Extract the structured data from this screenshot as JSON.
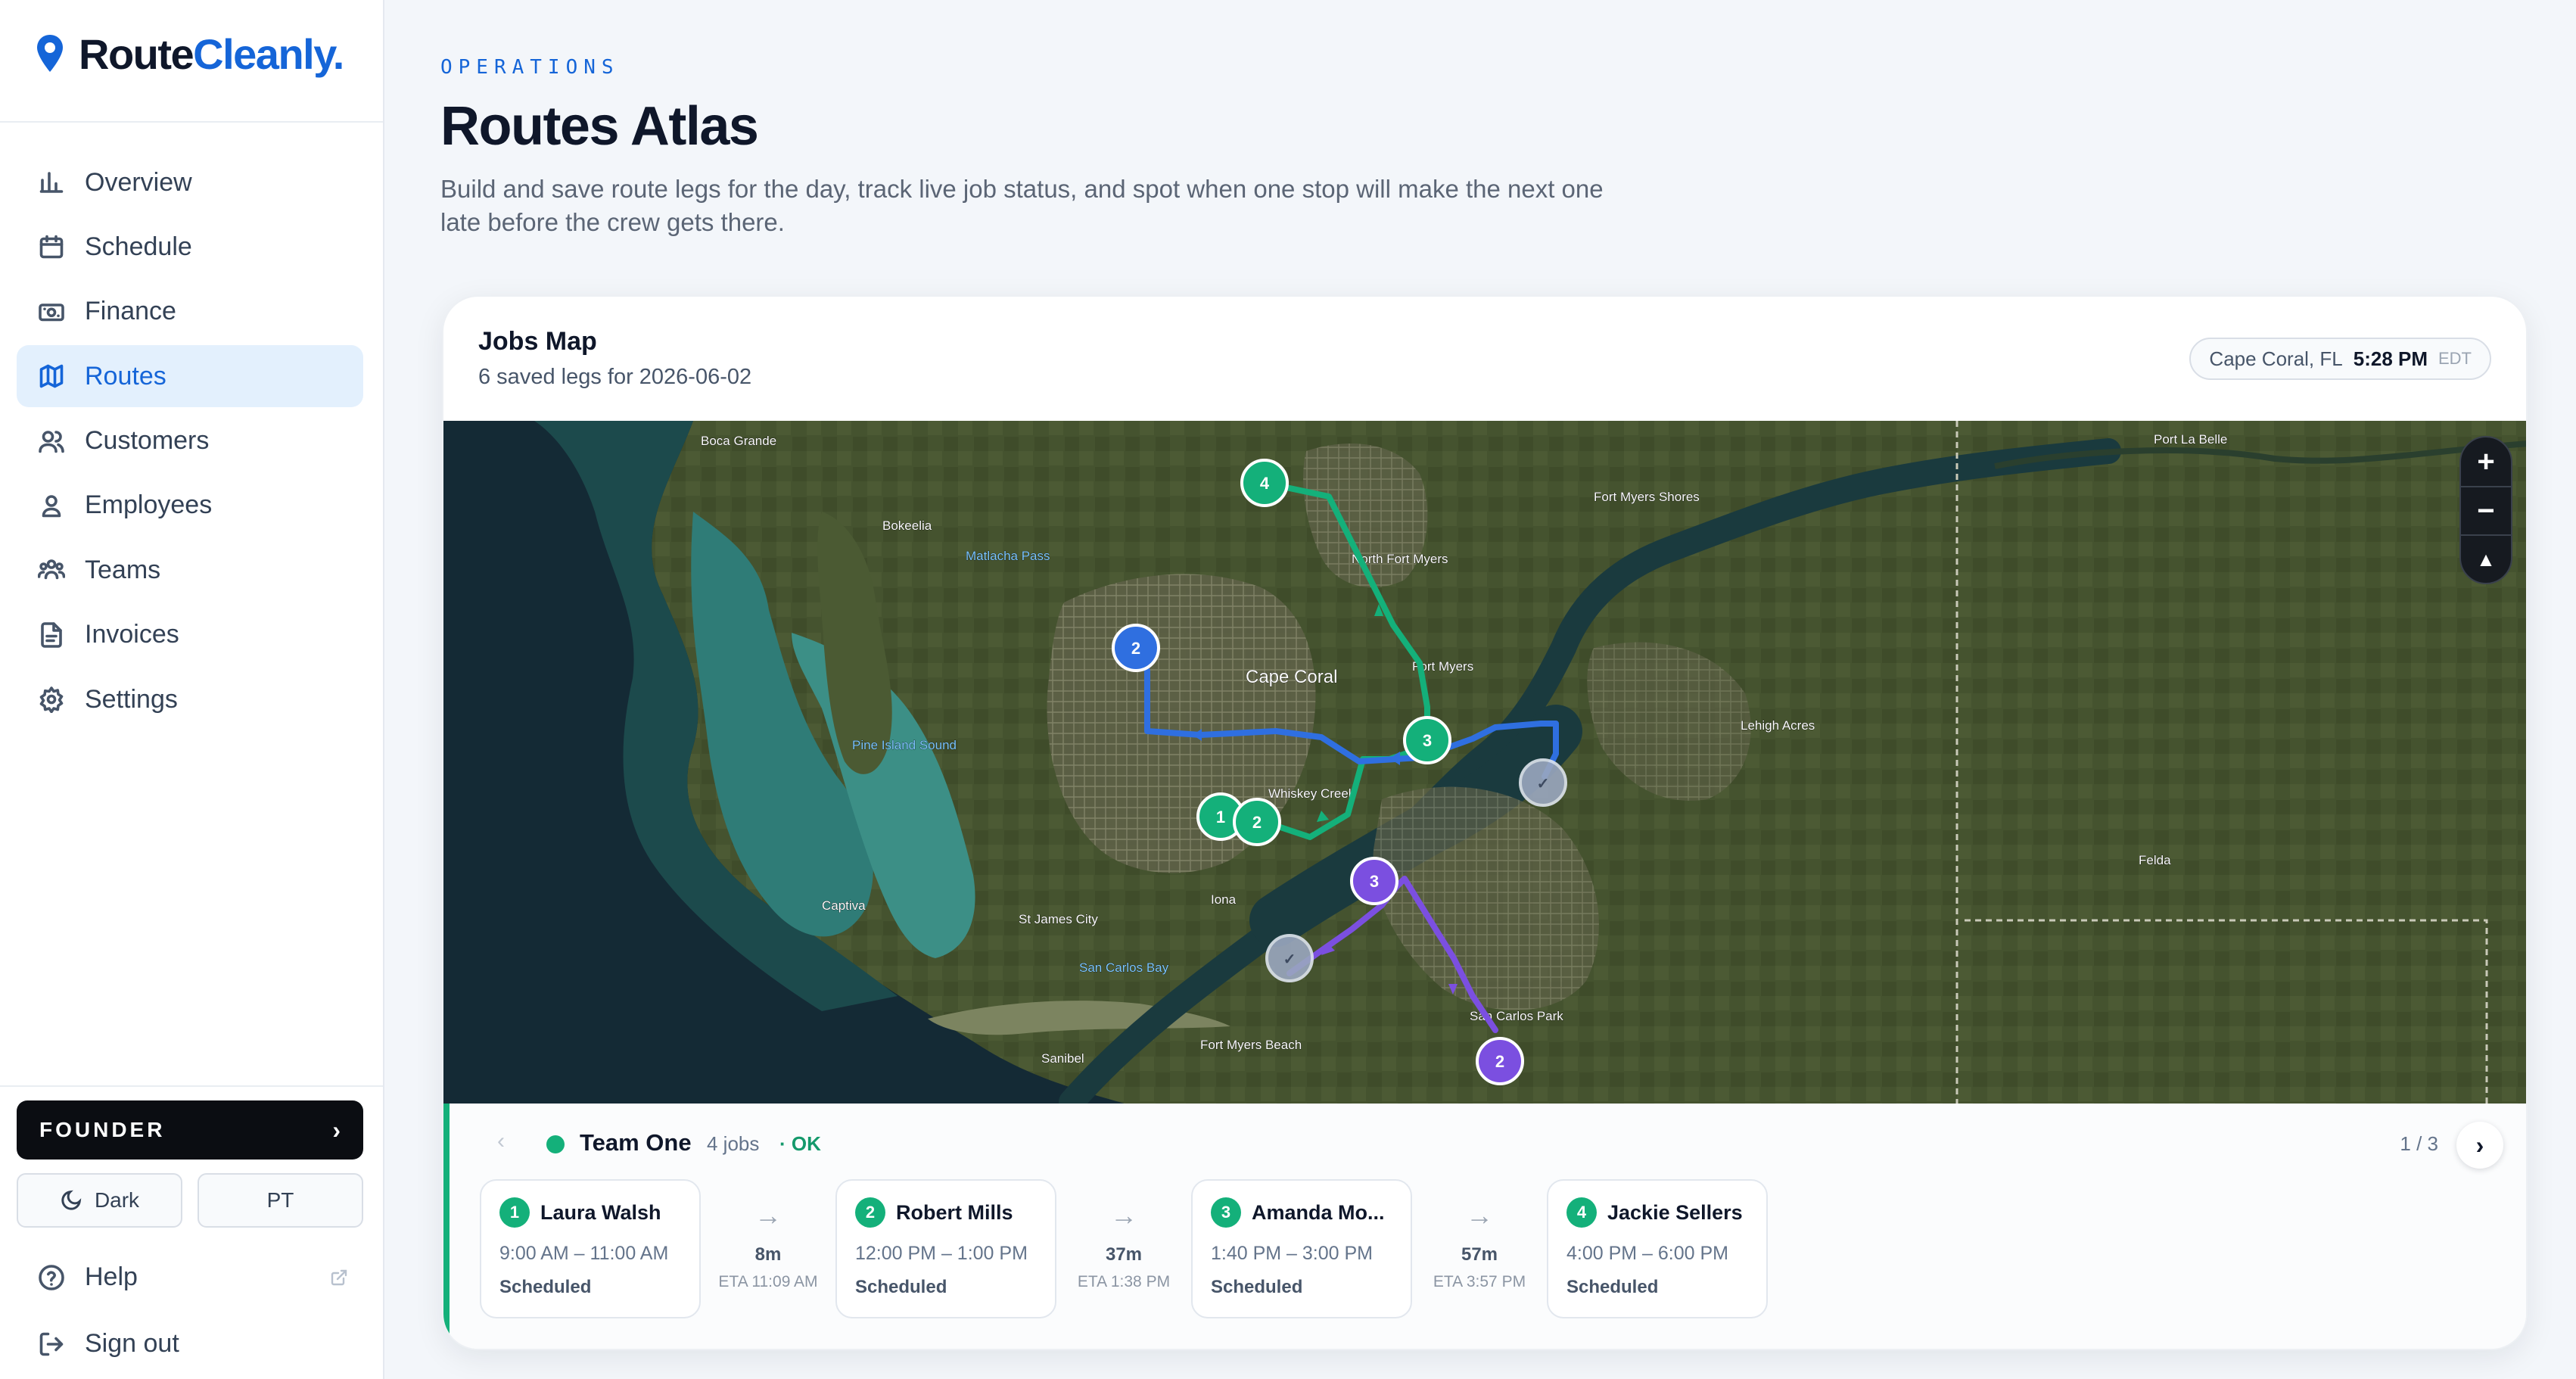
{
  "brand": {
    "part1": "Route",
    "part2": "Cleanly",
    "dot": "."
  },
  "sidebar": {
    "items": [
      {
        "label": "Overview",
        "icon": "bar-chart-icon"
      },
      {
        "label": "Schedule",
        "icon": "calendar-icon"
      },
      {
        "label": "Finance",
        "icon": "banknote-icon"
      },
      {
        "label": "Routes",
        "icon": "map-icon",
        "active": true
      },
      {
        "label": "Customers",
        "icon": "users-icon"
      },
      {
        "label": "Employees",
        "icon": "user-icon"
      },
      {
        "label": "Teams",
        "icon": "team-icon"
      },
      {
        "label": "Invoices",
        "icon": "file-icon"
      },
      {
        "label": "Settings",
        "icon": "gear-icon"
      }
    ],
    "founder_label": "FOUNDER",
    "founder_chevron": "›",
    "dark_label": "Dark",
    "pt_label": "PT",
    "help_label": "Help",
    "signout_label": "Sign out"
  },
  "header": {
    "eyebrow": "OPERATIONS",
    "title": "Routes Atlas",
    "description": "Build and save route legs for the day, track live job status, and spot when one stop will make the next one late before the crew gets there."
  },
  "card": {
    "title": "Jobs Map",
    "subtitle": "6 saved legs for 2026-06-02",
    "location": "Cape Coral, FL",
    "time": "5:28 PM",
    "timezone": "EDT"
  },
  "map": {
    "zoom_in": "+",
    "zoom_out": "−",
    "compass": "▲",
    "labels": {
      "boca_grande": "Boca Grande",
      "bokeelia": "Bokeelia",
      "matlacha": "Matlacha Pass",
      "pine_island": "Pine Island Sound",
      "cape_coral": "Cape Coral",
      "north_fort_myers": "North Fort Myers",
      "fort_myers": "Fort Myers",
      "fort_myers_shores": "Fort Myers Shores",
      "lehigh_acres": "Lehigh Acres",
      "whiskey_creek": "Whiskey Creek",
      "captiva": "Captiva",
      "st_james_city": "St James City",
      "iona": "Iona",
      "san_carlos_bay": "San Carlos Bay",
      "sanibel": "Sanibel",
      "fort_myers_beach": "Fort Myers Beach",
      "san_carlos_park": "San Carlos Park",
      "felda": "Felda",
      "port_la_belle": "Port La Belle"
    },
    "colors": {
      "team_one": "#14b07a",
      "team_two": "#2f6fe0",
      "team_three": "#7b4fe0",
      "done": "#9aa7bf"
    }
  },
  "team": {
    "name": "Team One",
    "jobs": "4 jobs",
    "status": "· OK",
    "pager": "1 / 3",
    "prev": "‹",
    "next": "›",
    "stops": [
      {
        "num": "1",
        "name": "Laura Walsh",
        "time": "9:00 AM – 11:00 AM",
        "status": "Scheduled"
      },
      {
        "num": "2",
        "name": "Robert Mills",
        "time": "12:00 PM – 1:00 PM",
        "status": "Scheduled"
      },
      {
        "num": "3",
        "name": "Amanda Mo...",
        "time": "1:40 PM – 3:00 PM",
        "status": "Scheduled"
      },
      {
        "num": "4",
        "name": "Jackie Sellers",
        "time": "4:00 PM – 6:00 PM",
        "status": "Scheduled"
      }
    ],
    "legs": [
      {
        "arrow": "→",
        "duration": "8m",
        "eta": "ETA 11:09 AM"
      },
      {
        "arrow": "→",
        "duration": "37m",
        "eta": "ETA 1:38 PM"
      },
      {
        "arrow": "→",
        "duration": "57m",
        "eta": "ETA 3:57 PM"
      }
    ]
  }
}
